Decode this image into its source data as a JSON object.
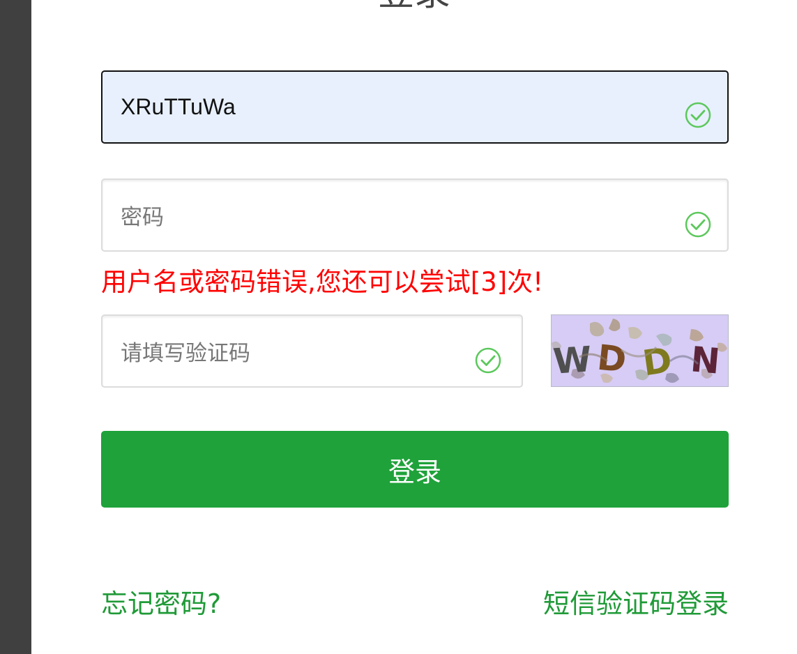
{
  "login": {
    "title": "登录",
    "username": {
      "value": "XRuTTuWa"
    },
    "password": {
      "placeholder": "密码"
    },
    "error_message": "用户名或密码错误,您还可以尝试[3]次!",
    "captcha_input": {
      "placeholder": "请填写验证码"
    },
    "captcha_image": {
      "text": "WDDN"
    },
    "submit_label": "登录",
    "forgot_password_link": "忘记密码?",
    "sms_login_link": "短信验证码登录"
  },
  "colors": {
    "primary_green": "#1fa23a",
    "error_red": "#ff0000",
    "focused_field_bg": "#e8f0fe",
    "valid_check": "#5cc85c"
  },
  "icons": [
    "check-circle-icon"
  ]
}
